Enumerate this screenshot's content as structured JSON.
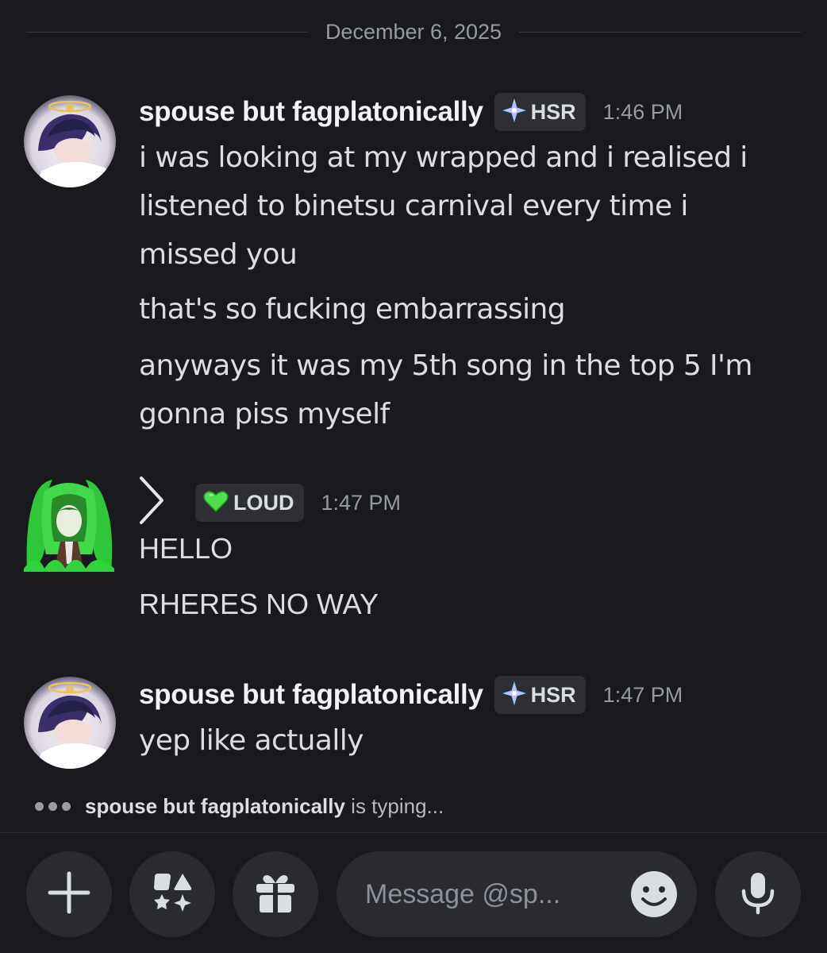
{
  "divider": {
    "date": "December 6, 2025"
  },
  "messages": [
    {
      "username": "spouse but fagplatonically",
      "tag": "HSR",
      "time": "1:46 PM",
      "lines": [
        "i was looking at my wrapped and i realised i",
        "listened to binetsu carnival every time i",
        "missed you",
        "that's so fucking embarrassing",
        "anyways it was my 5th song in the top 5 I'm",
        "gonna piss myself"
      ]
    },
    {
      "username": "",
      "tag": "LOUD",
      "time": "1:47 PM",
      "lines": [
        "HELLO",
        "RHERES NO WAY"
      ]
    },
    {
      "username": "spouse but fagplatonically",
      "tag": "HSR",
      "time": "1:47 PM",
      "lines": [
        "yep like actually"
      ]
    }
  ],
  "typing": {
    "user": "spouse but fagplatonically",
    "suffix": "is typing..."
  },
  "composer": {
    "placeholder": "Message @sp..."
  },
  "icons": {
    "add": "plus-icon",
    "apps": "apps-icon",
    "gift": "gift-icon",
    "emoji": "emoji-icon",
    "mic": "microphone-icon"
  },
  "colors": {
    "background": "#1a1a1e",
    "surface": "#2a2b30",
    "tag_bg": "#2e2f35",
    "loud_heart": "#4ee04a",
    "hsr_gem": "#c9a0ff"
  }
}
